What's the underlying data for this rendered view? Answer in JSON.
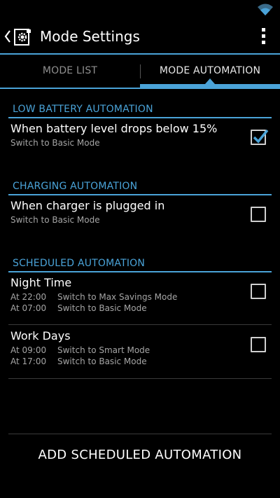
{
  "action_bar": {
    "title": "Mode Settings"
  },
  "tabs": [
    {
      "label": "MODE LIST",
      "selected": false
    },
    {
      "label": "MODE AUTOMATION",
      "selected": true
    }
  ],
  "low_battery": {
    "header": "LOW BATTERY AUTOMATION",
    "title": "When battery level drops below 15%",
    "subtitle": "Switch to Basic Mode",
    "checked": true
  },
  "charging": {
    "header": "CHARGING AUTOMATION",
    "title": "When charger is plugged in",
    "subtitle": "Switch to Basic Mode",
    "checked": false
  },
  "scheduled": {
    "header": "SCHEDULED AUTOMATION",
    "items": [
      {
        "title": "Night Time",
        "checked": false,
        "rows": [
          {
            "time": "At 22:00",
            "action": "Switch to Max Savings Mode"
          },
          {
            "time": "At 07:00",
            "action": "Switch to Basic Mode"
          }
        ]
      },
      {
        "title": "Work Days",
        "checked": false,
        "rows": [
          {
            "time": "At 09:00",
            "action": "Switch to Smart Mode"
          },
          {
            "time": "At 17:00",
            "action": "Switch to Basic Mode"
          }
        ]
      }
    ]
  },
  "add_button": {
    "label": "ADD SCHEDULED AUTOMATION"
  },
  "colors": {
    "accent": "#4aa3d8",
    "background": "#000000",
    "secondary_text": "#a5a5a5"
  },
  "icons": [
    "wifi-icon",
    "up-arrow-icon",
    "app-settings-icon",
    "overflow-menu-icon",
    "checkmark-icon"
  ]
}
